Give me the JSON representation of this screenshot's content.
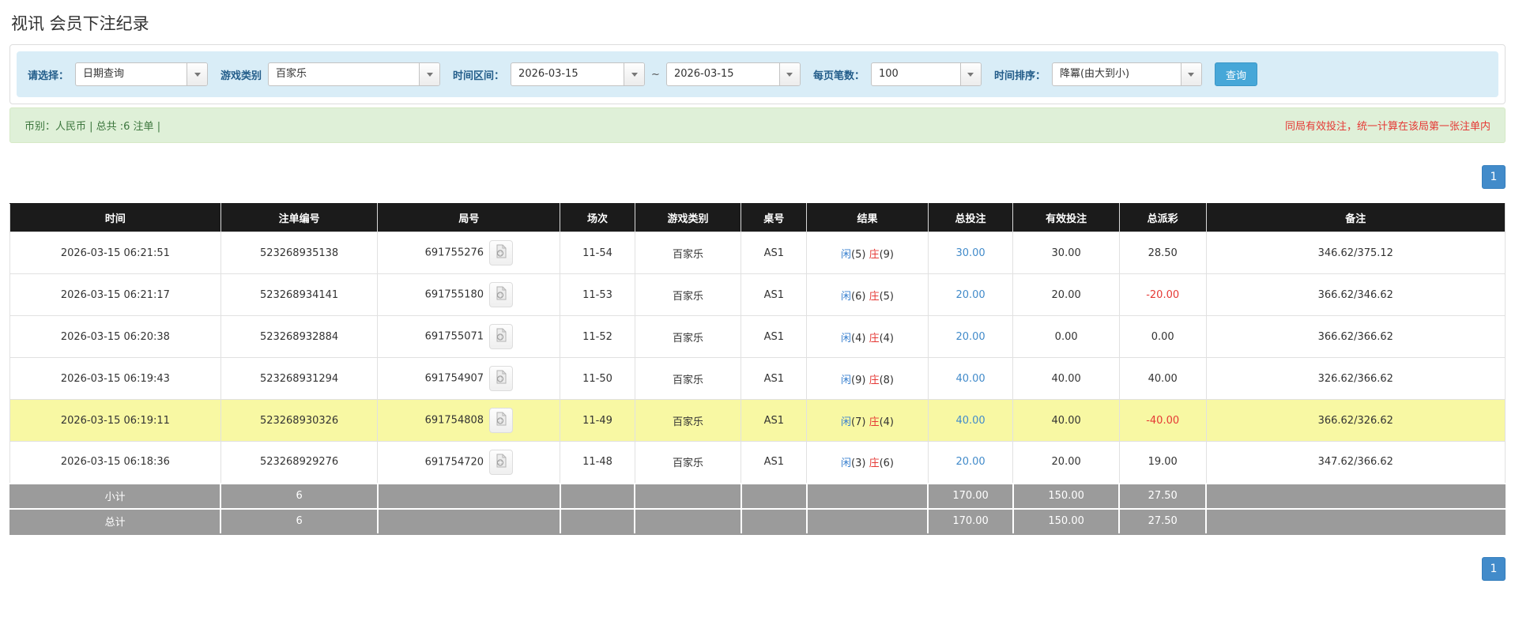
{
  "page_title": "视讯 会员下注纪录",
  "filters": {
    "select_label": "请选择：",
    "select_value": "日期查询",
    "game_label": "游戏类别",
    "game_value": "百家乐",
    "range_label": "时间区间：",
    "range_from": "2026-03-15",
    "tilde": "~",
    "range_to": "2026-03-15",
    "page_size_label": "每页笔数：",
    "page_size_value": "100",
    "sort_label": "时间排序：",
    "sort_value": "降冪(由大到小)",
    "search_button_label": "查询"
  },
  "summary_bar": {
    "left_text": "币别：人民币 | 总共 :6 注单 |",
    "right_note": "同局有效投注，统一计算在该局第一张注单内"
  },
  "pagination": {
    "top_page": "1",
    "bottom_page": "1"
  },
  "table": {
    "headers": [
      "时间",
      "注单编号",
      "局号",
      "场次",
      "游戏类别",
      "桌号",
      "结果",
      "总投注",
      "有效投注",
      "总派彩",
      "备注"
    ],
    "rows": [
      {
        "time": "2026-03-15 06:21:51",
        "bet_no": "523268935138",
        "round_no": "691755276",
        "session": "11-54",
        "game": "百家乐",
        "table_no": "AS1",
        "result": {
          "player_label": "闲",
          "player_score": "(5)",
          "banker_label": "庄",
          "banker_score": "(9)"
        },
        "total_bet": "30.00",
        "valid_bet": "30.00",
        "payout": "28.50",
        "note": "346.62/375.12",
        "highlighted": false
      },
      {
        "time": "2026-03-15 06:21:17",
        "bet_no": "523268934141",
        "round_no": "691755180",
        "session": "11-53",
        "game": "百家乐",
        "table_no": "AS1",
        "result": {
          "player_label": "闲",
          "player_score": "(6)",
          "banker_label": "庄",
          "banker_score": "(5)"
        },
        "total_bet": "20.00",
        "valid_bet": "20.00",
        "payout": "-20.00",
        "note": "366.62/346.62",
        "highlighted": false
      },
      {
        "time": "2026-03-15 06:20:38",
        "bet_no": "523268932884",
        "round_no": "691755071",
        "session": "11-52",
        "game": "百家乐",
        "table_no": "AS1",
        "result": {
          "player_label": "闲",
          "player_score": "(4)",
          "banker_label": "庄",
          "banker_score": "(4)"
        },
        "total_bet": "20.00",
        "valid_bet": "0.00",
        "payout": "0.00",
        "note": "366.62/366.62",
        "highlighted": false
      },
      {
        "time": "2026-03-15 06:19:43",
        "bet_no": "523268931294",
        "round_no": "691754907",
        "session": "11-50",
        "game": "百家乐",
        "table_no": "AS1",
        "result": {
          "player_label": "闲",
          "player_score": "(9)",
          "banker_label": "庄",
          "banker_score": "(8)"
        },
        "total_bet": "40.00",
        "valid_bet": "40.00",
        "payout": "40.00",
        "note": "326.62/366.62",
        "highlighted": false
      },
      {
        "time": "2026-03-15 06:19:11",
        "bet_no": "523268930326",
        "round_no": "691754808",
        "session": "11-49",
        "game": "百家乐",
        "table_no": "AS1",
        "result": {
          "player_label": "闲",
          "player_score": "(7)",
          "banker_label": "庄",
          "banker_score": "(4)"
        },
        "total_bet": "40.00",
        "valid_bet": "40.00",
        "payout": "-40.00",
        "note": "366.62/326.62",
        "highlighted": true
      },
      {
        "time": "2026-03-15 06:18:36",
        "bet_no": "523268929276",
        "round_no": "691754720",
        "session": "11-48",
        "game": "百家乐",
        "table_no": "AS1",
        "result": {
          "player_label": "闲",
          "player_score": "(3)",
          "banker_label": "庄",
          "banker_score": "(6)"
        },
        "total_bet": "20.00",
        "valid_bet": "20.00",
        "payout": "19.00",
        "note": "347.62/366.62",
        "highlighted": false
      }
    ],
    "footer_rows": [
      {
        "label": "小计",
        "count": "6",
        "total_bet": "170.00",
        "valid_bet": "150.00",
        "payout": "27.50"
      },
      {
        "label": "总计",
        "count": "6",
        "total_bet": "170.00",
        "valid_bet": "150.00",
        "payout": "27.50"
      }
    ]
  },
  "colors": {
    "accent_blue": "#428bca",
    "button_blue": "#46a7d8",
    "filter_bar_bg": "#d9edf7",
    "filter_label_blue": "#235d8a",
    "summary_bg": "#dff0d8",
    "summary_text_green": "#3c763d",
    "alert_red": "#e53935",
    "player_blue": "#3b82d0",
    "banker_red": "#e53935",
    "highlight_yellow": "#f8f8a3",
    "table_header_bg": "#1b1b1b",
    "table_footer_bg": "#9b9b9b"
  }
}
